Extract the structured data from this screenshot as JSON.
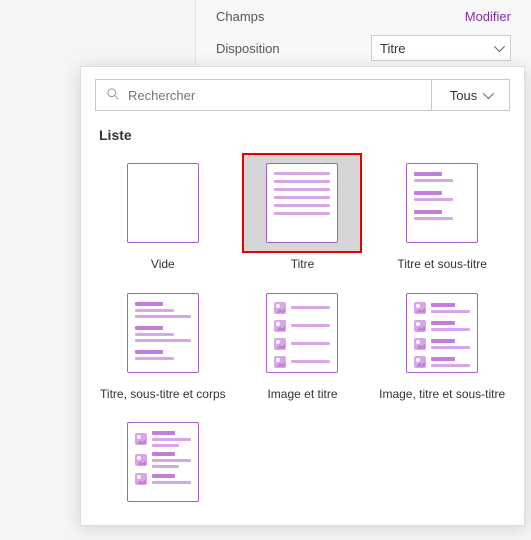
{
  "panel": {
    "fields_label": "Champs",
    "fields_action": "Modifier",
    "layout_label": "Disposition",
    "layout_value": "Titre"
  },
  "popup": {
    "search_placeholder": "Rechercher",
    "filter_label": "Tous",
    "group_title": "Liste",
    "tiles": [
      {
        "id": "vide",
        "label": "Vide"
      },
      {
        "id": "titre",
        "label": "Titre",
        "selected": true
      },
      {
        "id": "titre-sous",
        "label": "Titre et sous-titre"
      },
      {
        "id": "titre-sous-corps",
        "label": "Titre, sous-titre et corps"
      },
      {
        "id": "image-titre",
        "label": "Image et titre"
      },
      {
        "id": "image-titre-sous",
        "label": "Image, titre et sous-titre"
      },
      {
        "id": "image-corps",
        "label": ""
      }
    ]
  }
}
